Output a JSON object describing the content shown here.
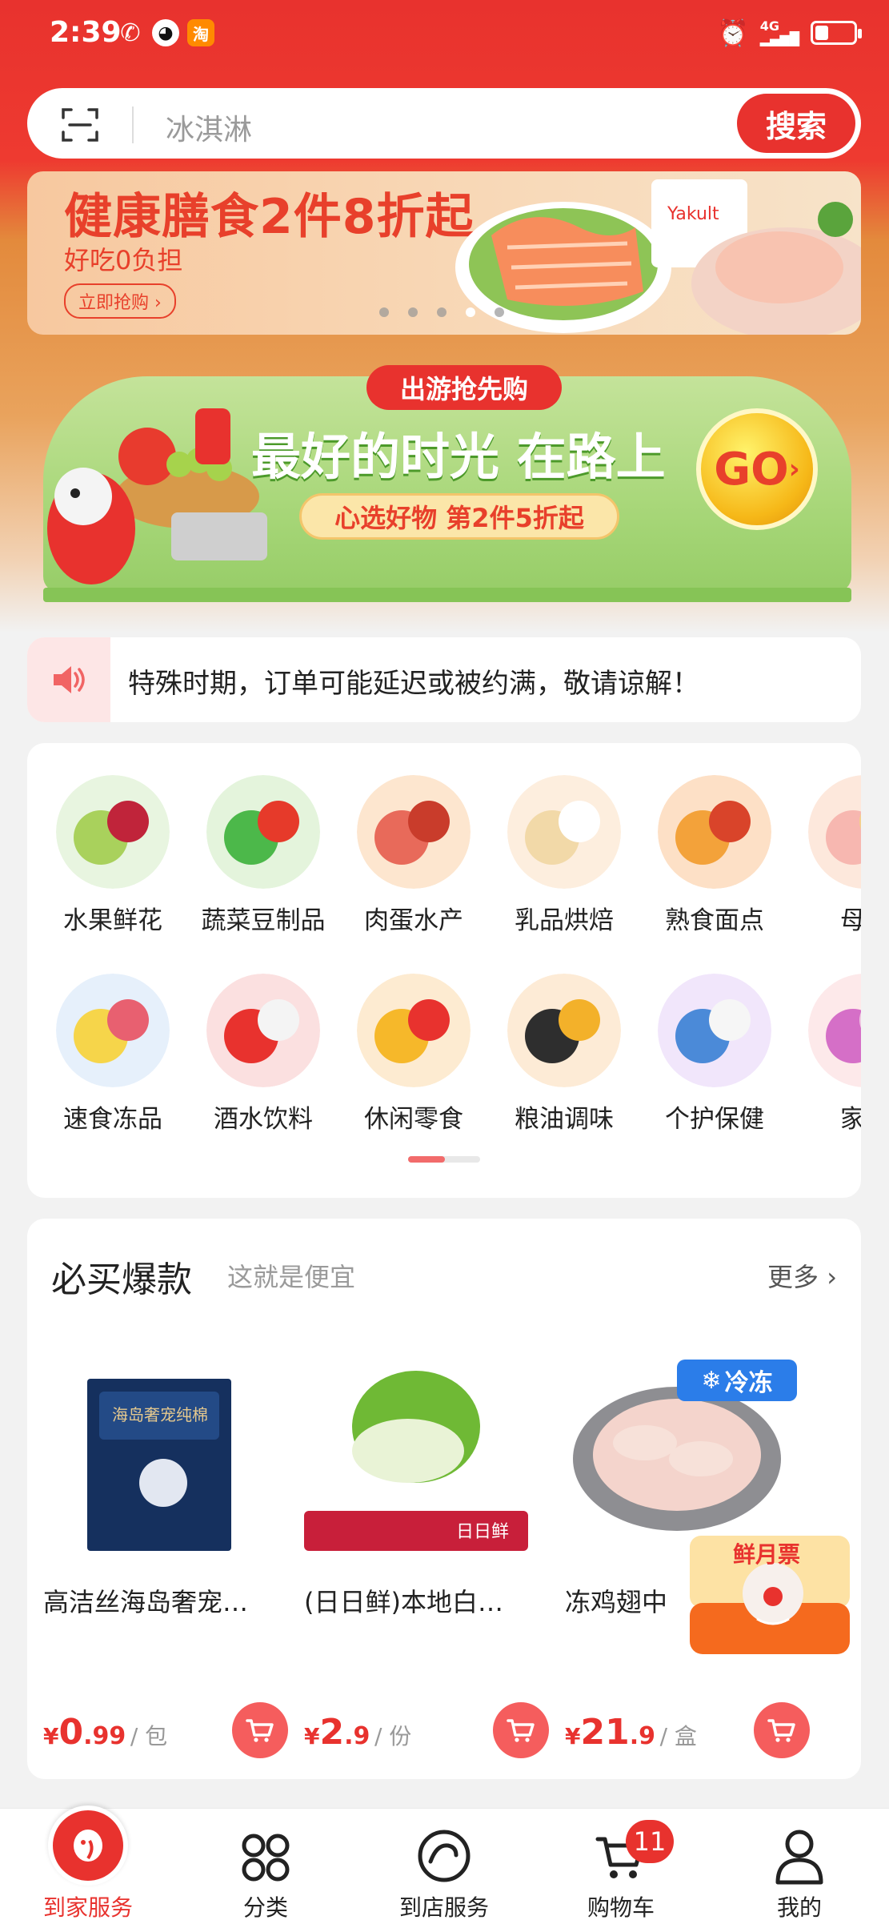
{
  "status_bar": {
    "time": "2:39",
    "taobao_label": "淘",
    "network": "4G",
    "battery_level": 0.35
  },
  "search": {
    "placeholder": "冰淇淋",
    "button": "搜索"
  },
  "banner1": {
    "title": "健康膳食2件8折起",
    "subtitle": "好吃0负担",
    "button": "立即抢购",
    "dots": 5,
    "active_dot": 3
  },
  "banner2": {
    "tag": "出游抢先购",
    "title": "最好的时光 在路上",
    "pill": "心选好物 第2件5折起",
    "go": "GO"
  },
  "notice": {
    "text": "特殊时期，订单可能延迟或被约满，敬请谅解！"
  },
  "categories": [
    {
      "label": "水果鲜花",
      "icon": "fruit-icon"
    },
    {
      "label": "蔬菜豆制品",
      "icon": "vegetable-icon"
    },
    {
      "label": "肉蛋水产",
      "icon": "meat-icon"
    },
    {
      "label": "乳品烘焙",
      "icon": "dairy-icon"
    },
    {
      "label": "熟食面点",
      "icon": "cooked-food-icon"
    },
    {
      "label": "母婴",
      "icon": "baby-icon"
    },
    {
      "label": "速食冻品",
      "icon": "frozen-food-icon"
    },
    {
      "label": "酒水饮料",
      "icon": "drinks-icon"
    },
    {
      "label": "休闲零食",
      "icon": "snacks-icon"
    },
    {
      "label": "粮油调味",
      "icon": "grain-oil-icon"
    },
    {
      "label": "个护保健",
      "icon": "personal-care-icon"
    },
    {
      "label": "家清",
      "icon": "household-icon"
    }
  ],
  "hot": {
    "title": "必买爆款",
    "subtitle": "这就是便宜",
    "more": "更多",
    "products": [
      {
        "name": "高洁丝海岛奢宠…",
        "price_int": "0",
        "price_dec": ".99",
        "unit": "/ 包",
        "currency": "¥"
      },
      {
        "name": "(日日鲜)本地白…",
        "price_int": "2",
        "price_dec": ".9",
        "unit": "/ 份",
        "currency": "¥"
      },
      {
        "name": "冻鸡翅中",
        "price_int": "21",
        "price_dec": ".9",
        "unit": "/ 盒",
        "currency": "¥"
      }
    ],
    "frozen_badge": "冷冻",
    "float_promo": "鲜月票"
  },
  "nav": [
    {
      "label": "到家服务",
      "icon": "home-service-icon",
      "active": true
    },
    {
      "label": "分类",
      "icon": "category-icon",
      "active": false
    },
    {
      "label": "到店服务",
      "icon": "store-service-icon",
      "active": false
    },
    {
      "label": "购物车",
      "icon": "cart-icon",
      "active": false,
      "badge": "11"
    },
    {
      "label": "我的",
      "icon": "profile-icon",
      "active": false
    }
  ],
  "colors": {
    "brand_red": "#e8322e",
    "frozen_blue": "#2b7de9"
  }
}
